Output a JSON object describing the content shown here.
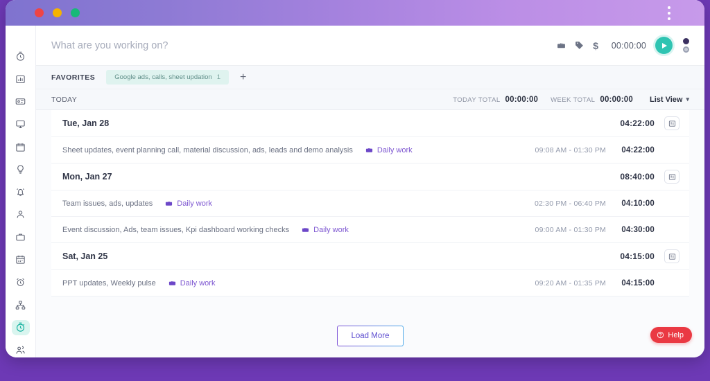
{
  "window": {
    "traffic_lights": [
      "close",
      "minimize",
      "maximize"
    ],
    "menu_icon": "kebab-menu-icon",
    "colors": {
      "desktop": "#6d39b5",
      "titlebar_from": "#7f73cf",
      "titlebar_to": "#c79aea",
      "accent_teal": "#2fc4b2",
      "accent_purple": "#7e57d1",
      "help_red": "#ea3943"
    }
  },
  "sidebar": {
    "items": [
      {
        "icon": "stopwatch-icon",
        "label": "Timer",
        "active": false
      },
      {
        "icon": "bar-chart-icon",
        "label": "Reports",
        "active": false
      },
      {
        "icon": "id-card-icon",
        "label": "Timesheet",
        "active": false
      },
      {
        "icon": "monitor-icon",
        "label": "Screenshots",
        "active": false
      },
      {
        "icon": "calendar-box-icon",
        "label": "Calendar",
        "active": false
      },
      {
        "icon": "lightbulb-icon",
        "label": "Activity",
        "active": false
      },
      {
        "icon": "alarm-bell-icon",
        "label": "Alerts",
        "active": false
      },
      {
        "icon": "person-icon",
        "label": "Members",
        "active": false
      },
      {
        "icon": "briefcase-icon",
        "label": "Projects",
        "active": false
      },
      {
        "icon": "calendar-icon",
        "label": "Schedule",
        "active": false
      },
      {
        "icon": "alarm-clock-icon",
        "label": "Reminders",
        "active": false
      },
      {
        "icon": "org-chart-icon",
        "label": "Teams",
        "active": false
      },
      {
        "icon": "stopwatch-icon",
        "label": "Time Track",
        "active": true
      },
      {
        "icon": "users-icon",
        "label": "Clients",
        "active": false
      }
    ]
  },
  "topbar": {
    "task_placeholder": "What are you working on?",
    "task_value": "",
    "project_icon": "briefcase-icon",
    "tag_icon": "tag-icon",
    "billable_symbol": "$",
    "timer_value": "00:00:00",
    "start_label": "Start timer",
    "mode_timer": "timer-mode",
    "mode_manual": "manual-mode"
  },
  "favorites": {
    "label": "FAVORITES",
    "chips": [
      {
        "text": "Google ads, calls, sheet updation",
        "count": "1"
      }
    ],
    "add_label": "+"
  },
  "totals": {
    "today_label": "TODAY",
    "today_total_caption": "TODAY TOTAL",
    "today_total_value": "00:00:00",
    "week_total_caption": "WEEK TOTAL",
    "week_total_value": "00:00:00",
    "view_label": "List View",
    "view_chevron": "⌄"
  },
  "days": [
    {
      "date": "Tue, Jan 28",
      "total": "04:22:00",
      "menu_icon": "list-options-icon",
      "entries": [
        {
          "description": "Sheet updates, event planning call, material discussion, ads, leads and demo analysis",
          "project": "Daily work",
          "start": "09:08 AM",
          "dash": "-",
          "end": "01:30 PM",
          "duration": "04:22:00"
        }
      ]
    },
    {
      "date": "Mon, Jan 27",
      "total": "08:40:00",
      "menu_icon": "list-options-icon",
      "entries": [
        {
          "description": "Team issues, ads, updates",
          "project": "Daily work",
          "start": "02:30 PM",
          "dash": "-",
          "end": "06:40 PM",
          "duration": "04:10:00"
        },
        {
          "description": "Event discussion, Ads, team issues, Kpi dashboard working checks",
          "project": "Daily work",
          "start": "09:00 AM",
          "dash": "-",
          "end": "01:30 PM",
          "duration": "04:30:00"
        }
      ]
    },
    {
      "date": "Sat, Jan 25",
      "total": "04:15:00",
      "menu_icon": "list-options-icon",
      "entries": [
        {
          "description": "PPT updates, Weekly pulse",
          "project": "Daily work",
          "start": "09:20 AM",
          "dash": "-",
          "end": "01:35 PM",
          "duration": "04:15:00"
        }
      ]
    }
  ],
  "footer": {
    "load_more_label": "Load More",
    "help_label": "Help",
    "help_icon": "question-circle-icon"
  }
}
